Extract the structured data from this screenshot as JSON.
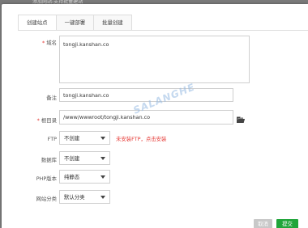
{
  "window": {
    "title": "添加网站-支持批量建站"
  },
  "tabs": [
    {
      "label": "创建站点",
      "active": true
    },
    {
      "label": "一键部署",
      "active": false
    },
    {
      "label": "批量创建",
      "active": false
    }
  ],
  "form": {
    "domain": {
      "label": "域名",
      "required": true,
      "value": "tongji.kanshan.co"
    },
    "remark": {
      "label": "备注",
      "value": "tongji.kanshan.co"
    },
    "root": {
      "label": "根目录",
      "required": true,
      "value": "/www/wwwroot/tongji.kanshan.co",
      "icon": "folder-icon"
    },
    "ftp": {
      "label": "FTP",
      "selected": "不创建",
      "warning": "未安装FTP，点击安装"
    },
    "database": {
      "label": "数据库",
      "selected": "不创建"
    },
    "php": {
      "label": "PHP版本",
      "selected": "纯静态"
    },
    "category": {
      "label": "网站分类",
      "selected": "默认分类"
    }
  },
  "footer": {
    "cancel_label": "取消",
    "submit_label": "提交"
  },
  "watermark": "SALANGHE",
  "colors": {
    "accent": "#20a53a",
    "warning": "#e53935",
    "required": "#e53935"
  }
}
